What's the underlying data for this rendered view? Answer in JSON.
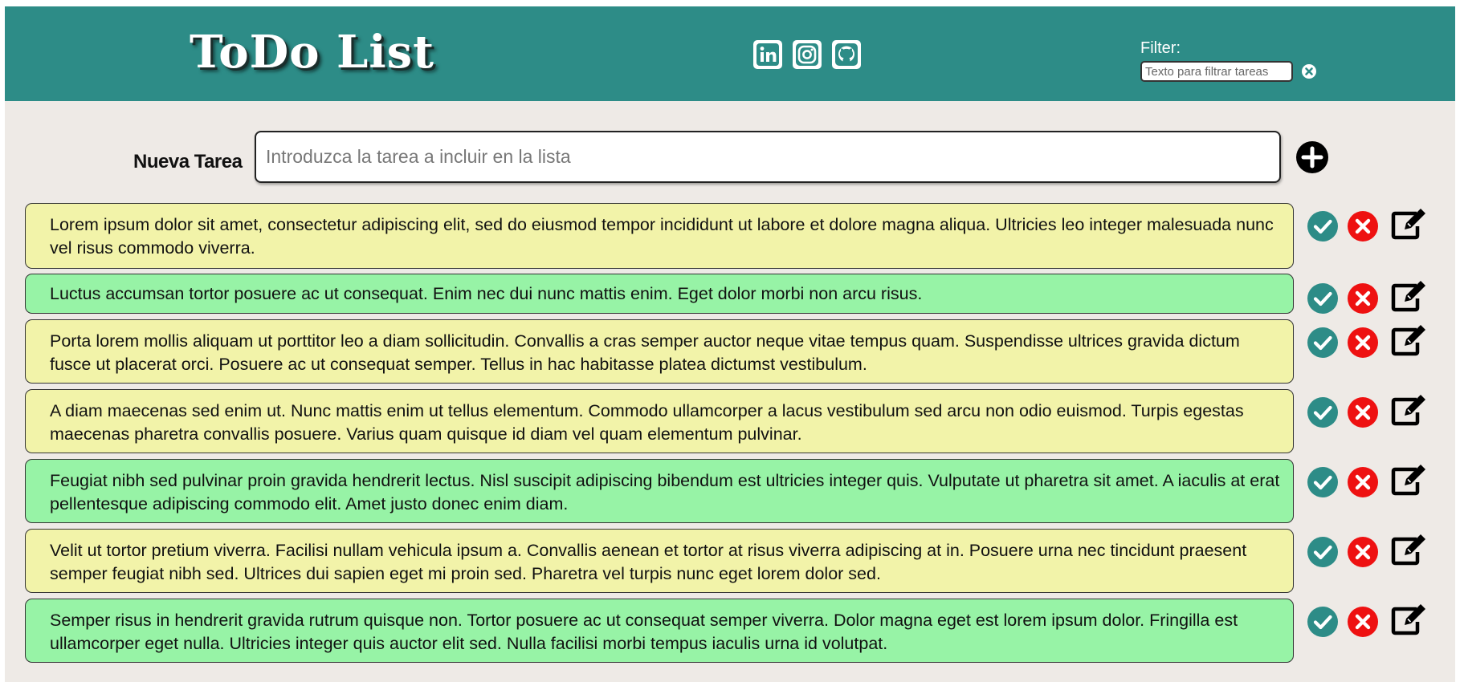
{
  "header": {
    "logo": "ToDo List",
    "social": [
      {
        "name": "linkedin",
        "icon": "linkedin-icon"
      },
      {
        "name": "instagram",
        "icon": "instagram-icon"
      },
      {
        "name": "github",
        "icon": "github-icon"
      }
    ],
    "filter": {
      "label": "Filter:",
      "placeholder": "Texto para filtrar tareas"
    }
  },
  "new_task": {
    "label": "Nueva Tarea",
    "placeholder": "Introduzca la tarea a incluir en la lista",
    "add_icon": "plus-circle-icon"
  },
  "colors": {
    "header": "#2d8c87",
    "background": "#eeeae6",
    "pending": "#f2f3a9",
    "done": "#97f3a6",
    "check": "#2d8c87",
    "delete": "#ee1111"
  },
  "tasks": [
    {
      "text": "Lorem ipsum dolor sit amet, consectetur adipiscing elit, sed do eiusmod tempor incididunt ut labore et dolore magna aliqua. Ultricies leo integer malesuada nunc vel risus commodo viverra.",
      "status": "pending"
    },
    {
      "text": "Luctus accumsan tortor posuere ac ut consequat. Enim nec dui nunc mattis enim. Eget dolor morbi non arcu risus.",
      "status": "done"
    },
    {
      "text": "Porta lorem mollis aliquam ut porttitor leo a diam sollicitudin. Convallis a cras semper auctor neque vitae tempus quam. Suspendisse ultrices gravida dictum fusce ut placerat orci. Posuere ac ut consequat semper. Tellus in hac habitasse platea dictumst vestibulum.",
      "status": "pending"
    },
    {
      "text": "A diam maecenas sed enim ut. Nunc mattis enim ut tellus elementum. Commodo ullamcorper a lacus vestibulum sed arcu non odio euismod. Turpis egestas maecenas pharetra convallis posuere. Varius quam quisque id diam vel quam elementum pulvinar.",
      "status": "pending"
    },
    {
      "text": "Feugiat nibh sed pulvinar proin gravida hendrerit lectus. Nisl suscipit adipiscing bibendum est ultricies integer quis. Vulputate ut pharetra sit amet. A iaculis at erat pellentesque adipiscing commodo elit. Amet justo donec enim diam.",
      "status": "done"
    },
    {
      "text": "Velit ut tortor pretium viverra. Facilisi nullam vehicula ipsum a. Convallis aenean et tortor at risus viverra adipiscing at in. Posuere urna nec tincidunt praesent semper feugiat nibh sed. Ultrices dui sapien eget mi proin sed. Pharetra vel turpis nunc eget lorem dolor sed.",
      "status": "pending"
    },
    {
      "text": "Semper risus in hendrerit gravida rutrum quisque non. Tortor posuere ac ut consequat semper viverra. Dolor magna eget est lorem ipsum dolor. Fringilla est ullamcorper eget nulla. Ultricies integer quis auctor elit sed. Nulla facilisi morbi tempus iaculis urna id volutpat.",
      "status": "done"
    }
  ]
}
